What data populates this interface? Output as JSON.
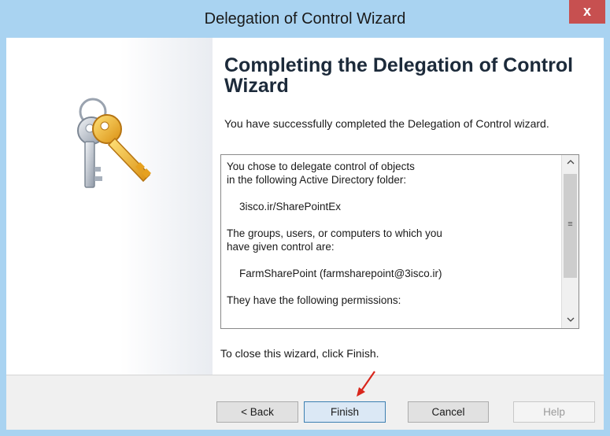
{
  "window": {
    "title": "Delegation of Control Wizard",
    "close_label": "x"
  },
  "page": {
    "heading": "Completing the Delegation of Control Wizard",
    "intro": "You have successfully completed the Delegation of Control wizard."
  },
  "summary": {
    "line1": "You chose to delegate control of objects",
    "line2": "in the following Active Directory folder:",
    "folder": "3isco.ir/SharePointEx",
    "line3": "The groups, users, or computers to which you",
    "line4": "have given control are:",
    "principal": "FarmSharePoint (farmsharepoint@3isco.ir)",
    "line5": "They have the following permissions:"
  },
  "scrollbar": {
    "up_glyph": "^",
    "down_glyph": "v",
    "grip_glyph": "≡"
  },
  "footer": {
    "note": "To close this wizard, click Finish."
  },
  "buttons": {
    "back": "< Back",
    "finish": "Finish",
    "cancel": "Cancel",
    "help": "Help"
  },
  "icons": {
    "wizard_image": "keys-icon",
    "annotation": "red-arrow-icon"
  },
  "colors": {
    "titlebar": "#a9d3f1",
    "close_button": "#c75050",
    "annotation_arrow": "#d9261c"
  }
}
